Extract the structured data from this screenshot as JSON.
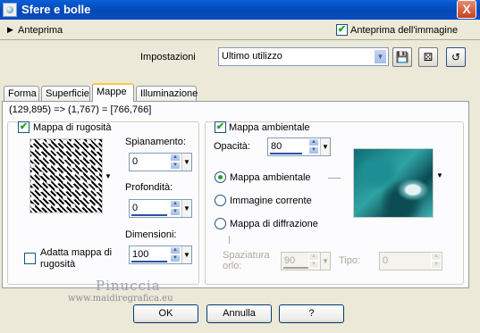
{
  "window": {
    "title": "Sfere e bolle",
    "close_symbol": "X"
  },
  "preview_row": {
    "toggle_label": "Anteprima",
    "image_preview_label": "Anteprima dell'immagine",
    "image_preview_checked": true
  },
  "settings": {
    "label": "Impostazioni",
    "selected": "Ultimo utilizzo"
  },
  "tabs": [
    {
      "label": "Forma"
    },
    {
      "label": "Superficie"
    },
    {
      "label": "Mappe"
    },
    {
      "label": "Illuminazione"
    }
  ],
  "active_tab": "Mappe",
  "coords_text": "(129,895) => (1,767) = [766,766]",
  "bump_map": {
    "label": "Mappa di rugosità",
    "checked": true,
    "smoothing_label": "Spianamento:",
    "smoothing_value": "0",
    "depth_label": "Profondità:",
    "depth_value": "0",
    "size_label": "Dimensioni:",
    "size_value": "100",
    "fit_label_line1": "Adatta mappa di",
    "fit_label_line2": "rugosità",
    "fit_checked": false
  },
  "env_map": {
    "label": "Mappa ambientale",
    "checked": true,
    "opacity_label": "Opacità:",
    "opacity_value": "80",
    "options": [
      {
        "label": "Mappa ambientale",
        "selected": true
      },
      {
        "label": "Immagine corrente",
        "selected": false
      },
      {
        "label": "Mappa di diffrazione",
        "selected": false
      }
    ],
    "spacing_label_line1": "Spaziatura",
    "spacing_label_line2": "orlo:",
    "spacing_value": "90",
    "type_label": "Tipo:",
    "type_value": "0"
  },
  "watermark": {
    "name": "Pinuccia",
    "url": "www.maidiregrafica.eu"
  },
  "buttons": {
    "ok": "OK",
    "cancel": "Annulla",
    "help": "?"
  }
}
